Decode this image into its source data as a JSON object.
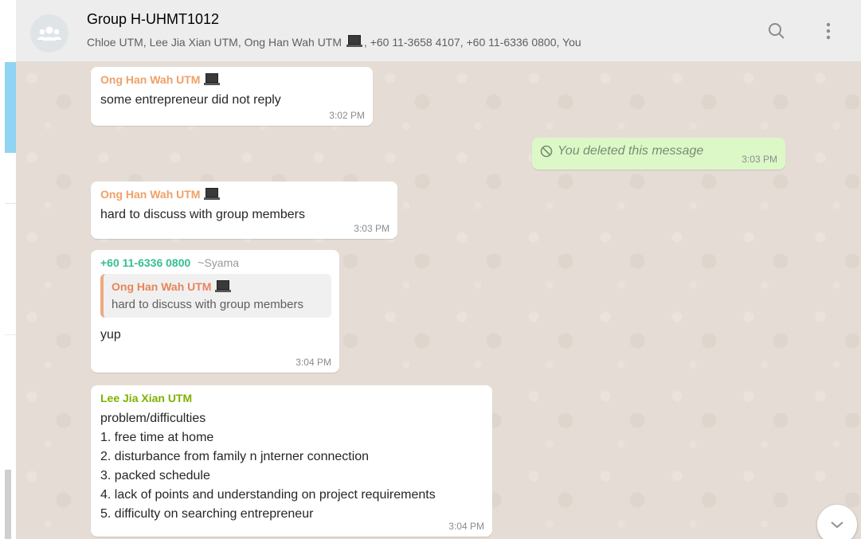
{
  "header": {
    "title": "Group H-UHMT1012",
    "subtitle_pre": "Chloe UTM, Lee Jia Xian UTM, Ong Han Wah UTM",
    "subtitle_post": ", +60 11-3658 4107, +60 11-6336 0800, You",
    "search_icon": "search-icon",
    "menu_icon": "more-vertical-icon"
  },
  "colors": {
    "header_bg": "#ededed",
    "chat_bg": "#e5ddd5",
    "outgoing_bubble": "#dcf8c6",
    "orange_name": "#f0a067",
    "green_name": "#35c08f",
    "olive_name": "#7fb100"
  },
  "messages": [
    {
      "sender": "Ong Han Wah UTM",
      "text": "some entrepreneur did not reply",
      "time": "3:02 PM"
    },
    {
      "text": "You deleted this message",
      "time": "3:03 PM"
    },
    {
      "sender": "Ong Han Wah UTM",
      "text": "hard to discuss with group members",
      "time": "3:03 PM"
    },
    {
      "sender": "+60 11-6336 0800",
      "sender_tag": "~Syama",
      "quote_sender": "Ong Han Wah UTM",
      "quote_text": "hard to discuss with group members",
      "text": "yup",
      "time": "3:04 PM"
    },
    {
      "sender": "Lee Jia Xian UTM",
      "lines": [
        "problem/difficulties",
        "1. free time at home",
        "2. disturbance from family n jnterner connection",
        "3. packed schedule",
        "4. lack of points and understanding on project requirements",
        "5. difficulty on searching entrepreneur"
      ],
      "time": "3:04 PM"
    }
  ]
}
